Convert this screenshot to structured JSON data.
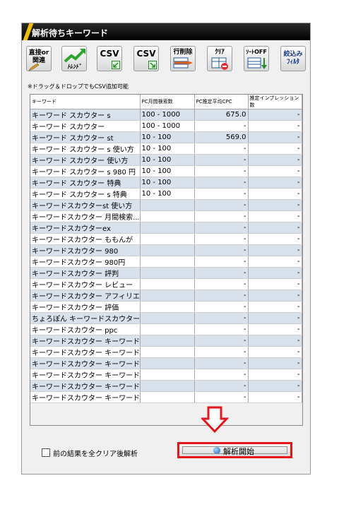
{
  "window": {
    "title": "解析待ちキーワード"
  },
  "toolbar": {
    "buttons": [
      {
        "label_top": "直接or",
        "label_bottom": "関連"
      },
      {
        "label_top": "",
        "label_bottom": "ﾄﾚﾝﾄﾞ"
      },
      {
        "label_top": "CSV",
        "label_bottom": ""
      },
      {
        "label_top": "CSV",
        "label_bottom": ""
      },
      {
        "label_top": "行削除",
        "label_bottom": ""
      },
      {
        "label_top": "ｸﾘｱ",
        "label_bottom": ""
      },
      {
        "label_top": "ｿｰﾄOFF",
        "label_bottom": ""
      },
      {
        "label_top": "絞込み",
        "label_bottom": "ﾌｨﾙﾀ"
      }
    ]
  },
  "hint": "※ドラッグ＆ドロップでもCSV追加可能",
  "table": {
    "headers": [
      "キーワード",
      "PC月間検索数",
      "PC推定平均CPC",
      "推定インプレッション数"
    ],
    "rows": [
      [
        "キーワード スカウター s",
        "100 - 1000",
        "675.0",
        "-"
      ],
      [
        "キーワード スカウター",
        "100 - 1000",
        "-",
        "-"
      ],
      [
        "キーワード スカウター st",
        "10 - 100",
        "569.0",
        "-"
      ],
      [
        "キーワード スカウター s 使い方",
        "10 - 100",
        "-",
        "-"
      ],
      [
        "キーワード スカウター 使い方",
        "10 - 100",
        "-",
        "-"
      ],
      [
        "キーワード スカウター s 980 円",
        "10 - 100",
        "-",
        "-"
      ],
      [
        "キーワード スカウター 特典",
        "10 - 100",
        "-",
        "-"
      ],
      [
        "キーワード スカウター s 特典",
        "10 - 100",
        "-",
        "-"
      ],
      [
        "キーワードスカウターst 使い方",
        "",
        "-",
        "-"
      ],
      [
        "キーワードスカウター 月間検索...",
        "",
        "-",
        "-"
      ],
      [
        "キーワードスカウターex",
        "",
        "-",
        "-"
      ],
      [
        "キーワードスカウター ももんが",
        "",
        "-",
        "-"
      ],
      [
        "キーワードスカウター 980",
        "",
        "-",
        "-"
      ],
      [
        "キーワードスカウター 980円",
        "",
        "-",
        "-"
      ],
      [
        "キーワードスカウター 評判",
        "",
        "-",
        "-"
      ],
      [
        "キーワードスカウター レビュー",
        "",
        "-",
        "-"
      ],
      [
        "キーワードスカウター アフィリエイト",
        "",
        "-",
        "-"
      ],
      [
        "キーワードスカウター 評価",
        "",
        "-",
        "-"
      ],
      [
        "ちょろぽん キーワードスカウター",
        "",
        "-",
        "-"
      ],
      [
        "キーワードスカウター ppc",
        "",
        "-",
        "-"
      ],
      [
        "キーワードスカウター キーワード...",
        "",
        "-",
        "-"
      ],
      [
        "キーワードスカウター キーワード...",
        "",
        "-",
        "-"
      ],
      [
        "キーワードスカウター キーワード...",
        "",
        "-",
        "-"
      ],
      [
        "キーワードスカウター キーワード...",
        "",
        "-",
        "-"
      ],
      [
        "キーワードスカウター キーワード...",
        "",
        "-",
        "-"
      ],
      [
        "キーワードスカウター キーワード...",
        "",
        "-",
        "-"
      ]
    ]
  },
  "footer": {
    "checkbox_label": "前の結果を全クリア後解析",
    "checkbox_checked": false,
    "start_label": "解析開始"
  },
  "colors": {
    "highlight": "#e8141b",
    "row_alt": "#d9e1ec",
    "titlebar": "#000000"
  }
}
